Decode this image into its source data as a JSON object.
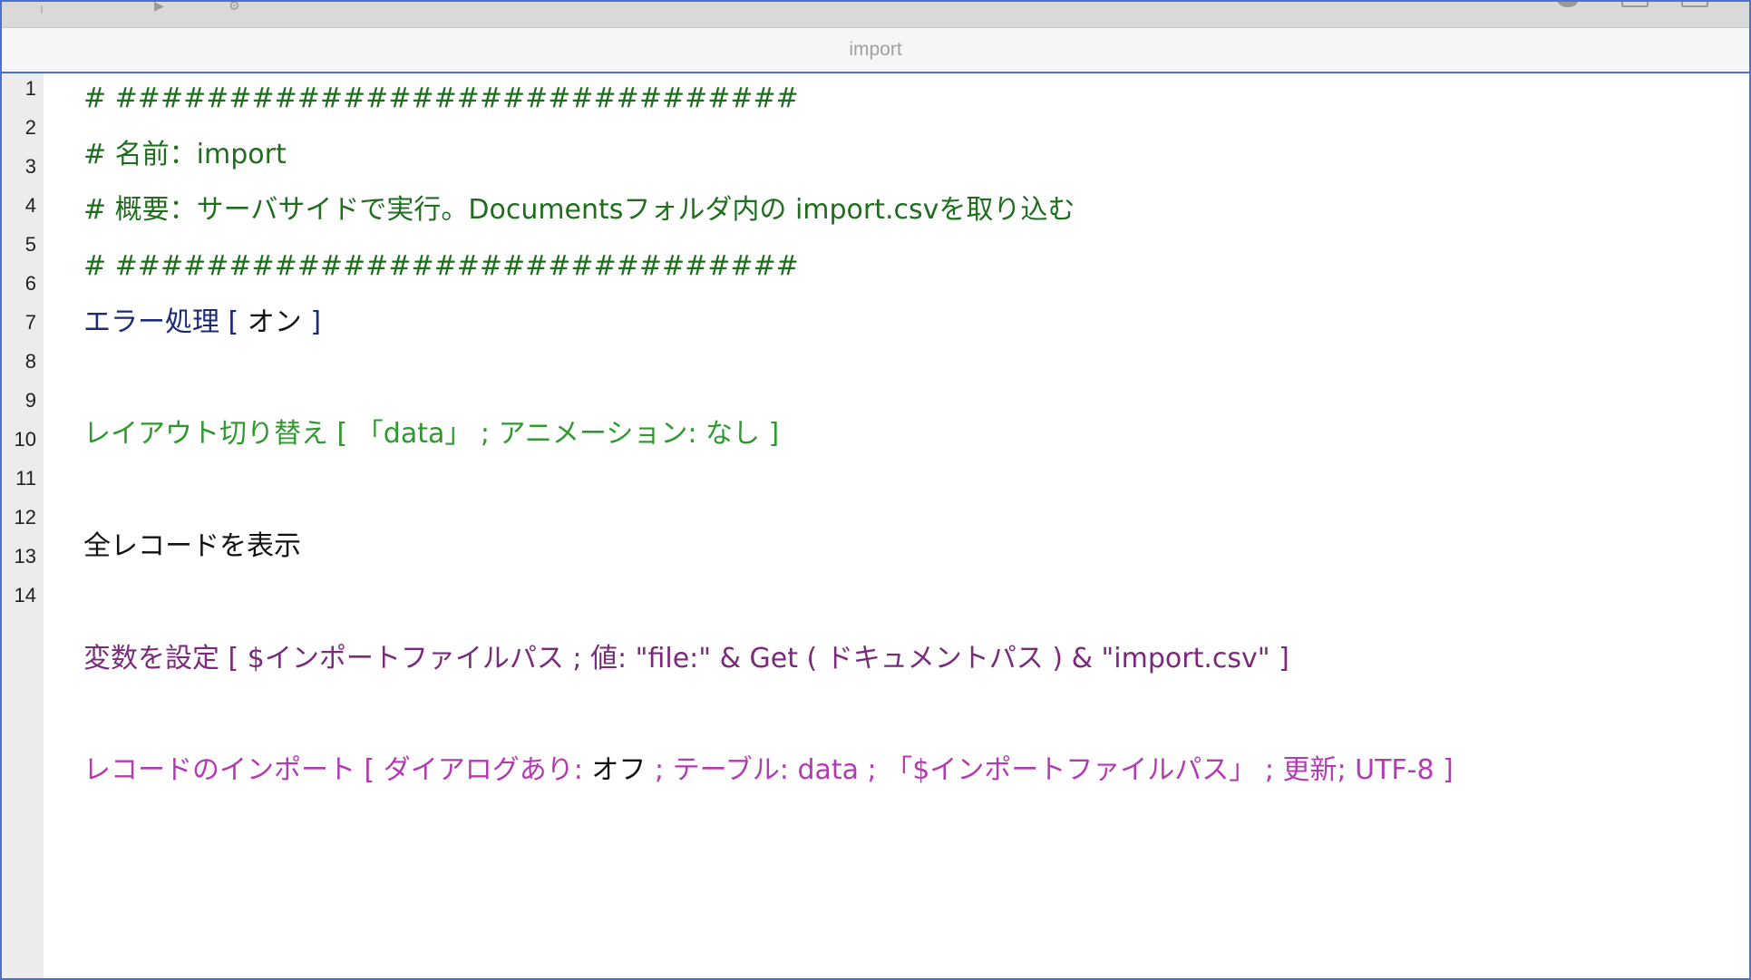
{
  "window": {
    "title": "import"
  },
  "toolbar": {
    "icons": [
      "play-icon",
      "gear-icon",
      "status-dot-icon",
      "panel-icon",
      "panel-icon"
    ]
  },
  "gutter": {
    "line_numbers": [
      "1",
      "2",
      "3",
      "4",
      "5",
      "6",
      "7",
      "8",
      "9",
      "10",
      "11",
      "12",
      "13",
      "14"
    ]
  },
  "script": {
    "comment_border_1": "# ##############################",
    "comment_name": "# 名前：import",
    "comment_summary": "# 概要：サーバサイドで実行。Documentsフォルダ内の import.csvを取り込む",
    "comment_border_2": "# ##############################",
    "error_step": "エラー処理 [ ",
    "error_value": "オン",
    "error_close": " ]",
    "layout_step": "レイアウト切り替え [ 「data」 ; アニメーション: なし ]",
    "show_all_step": "全レコードを表示",
    "set_var_step": "変数を設定 [ $インポートファイルパス ; 値: \"file:\" & Get ( ドキュメントパス ) & \"import.csv\" ]",
    "import_step_a": "レコードのインポート [ ダイアログあり: ",
    "import_value": "オフ",
    "import_step_b": " ; テーブル: data ; 「$インポートファイルパス」 ; 更新; UTF-8 ]"
  },
  "colors": {
    "frame_border": "#4a72c9",
    "comment": "#1e6e1e",
    "error_step": "#1a2a78",
    "layout_step": "#2e9a2e",
    "set_variable": "#7a2a7a",
    "import_step": "#b43ab4"
  }
}
